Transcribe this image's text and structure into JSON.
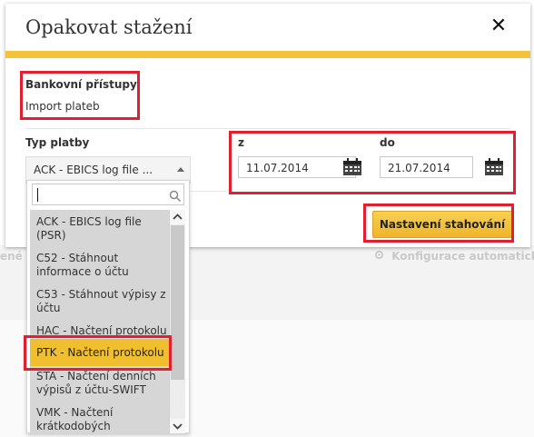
{
  "background": {
    "left_text": "ené",
    "right_text": "Konfigurace automatické"
  },
  "modal": {
    "title": "Opakovat stažení",
    "close_symbol": "✕",
    "bank_access_label": "Bankovní přístupy",
    "bank_access_value": "Import plateb",
    "payment_type_label": "Typ platby",
    "payment_type_selected": "ACK - EBICS log file ...",
    "date_from_label": "z",
    "date_from_value": "11.07.2014",
    "date_to_label": "do",
    "date_to_value": "21.07.2014",
    "submit_button": "Nastavení stahování"
  },
  "dropdown": {
    "search_value": "",
    "items": [
      {
        "line1": "ACK - EBICS log file",
        "line2": "(PSR)",
        "highlighted": false
      },
      {
        "line1": "C52 - Stáhnout",
        "line2": "informace o účtu",
        "highlighted": false
      },
      {
        "line1": "C53 - Stáhnout výpisy z",
        "line2": "účtu",
        "highlighted": false
      },
      {
        "line1": "HAC - Načtení protokolu",
        "line2": "",
        "highlighted": false
      },
      {
        "line1": "PTK - Načtení protokolu",
        "line2": "",
        "highlighted": true
      },
      {
        "line1": "STA - Načtení denních",
        "line2": "výpisů z účtu-SWIFT",
        "highlighted": false
      },
      {
        "line1": "VMK - Načtení",
        "line2": "krátkodobých",
        "highlighted": false
      }
    ]
  },
  "colors": {
    "accent": "#f5c33b",
    "highlight_box": "#e0202f",
    "selected_item": "#f0bf30"
  },
  "icons": [
    "close-icon",
    "calendar-icon",
    "search-icon",
    "gear-icon",
    "chevron-up-icon",
    "chevron-down-icon"
  ]
}
